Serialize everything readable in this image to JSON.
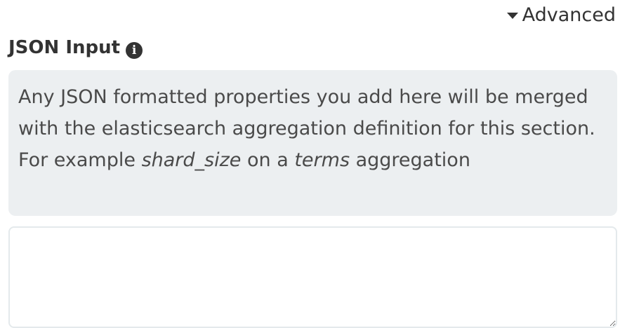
{
  "advanced": {
    "label": "Advanced",
    "icon": "caret-down-icon"
  },
  "json_input": {
    "label": "JSON Input",
    "info_icon": "info-icon",
    "info_glyph": "i",
    "help": {
      "part1": "Any JSON formatted properties you add here will be merged with the elasticsearch aggregation definition for this section. For example ",
      "em1": "shard_size",
      "part2": " on a ",
      "em2": "terms",
      "part3": " aggregation"
    },
    "value": ""
  },
  "colors": {
    "help_background": "#eceff1",
    "textarea_border": "#e4e9ec",
    "text": "#333333"
  }
}
